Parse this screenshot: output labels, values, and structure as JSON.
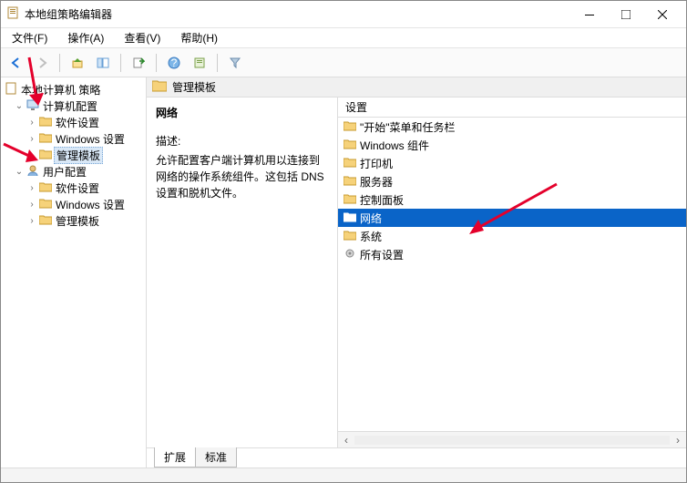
{
  "window": {
    "title": "本地组策略编辑器"
  },
  "menu": {
    "file": "文件(F)",
    "action": "操作(A)",
    "view": "查看(V)",
    "help": "帮助(H)"
  },
  "tree": {
    "root": "本地计算机 策略",
    "computer": "计算机配置",
    "c_soft": "软件设置",
    "c_win": "Windows 设置",
    "c_admin": "管理模板",
    "user": "用户配置",
    "u_soft": "软件设置",
    "u_win": "Windows 设置",
    "u_admin": "管理模板"
  },
  "path": {
    "label": "管理模板"
  },
  "desc": {
    "heading": "网络",
    "title": "描述:",
    "body": "允许配置客户端计算机用以连接到网络的操作系统组件。这包括 DNS 设置和脱机文件。"
  },
  "list": {
    "header": "设置",
    "items": [
      "\"开始\"菜单和任务栏",
      "Windows 组件",
      "打印机",
      "服务器",
      "控制面板",
      "网络",
      "系统",
      "所有设置"
    ],
    "selected_index": 5
  },
  "tabs": {
    "extended": "扩展",
    "standard": "标准"
  }
}
